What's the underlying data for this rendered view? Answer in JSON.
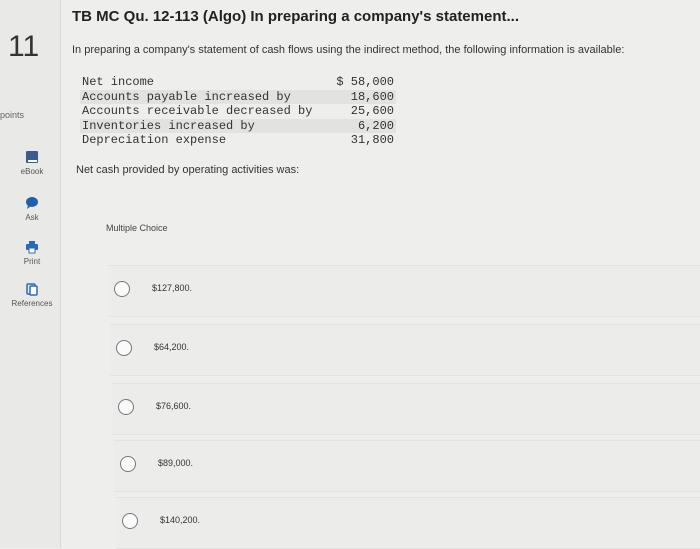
{
  "question": {
    "number": "11",
    "points_label": "points",
    "title": "TB MC Qu. 12-113 (Algo) In preparing a company's statement...",
    "intro": "In preparing a company's statement of cash flows using the indirect method, the following information is available:",
    "table": [
      {
        "label": "Net income",
        "value": "$ 58,000"
      },
      {
        "label": "Accounts payable increased by",
        "value": "18,600"
      },
      {
        "label": "Accounts receivable decreased by",
        "value": "25,600"
      },
      {
        "label": "Inventories increased by",
        "value": "6,200"
      },
      {
        "label": "Depreciation expense",
        "value": "31,800"
      }
    ],
    "prompt": "Net cash provided by operating activities was:",
    "choice_type_label": "Multiple Choice",
    "options": [
      {
        "text": "$127,800."
      },
      {
        "text": "$64,200."
      },
      {
        "text": "$76,600."
      },
      {
        "text": "$89,000."
      },
      {
        "text": "$140,200."
      }
    ]
  },
  "sidebar": {
    "tools": [
      {
        "label": "eBook",
        "icon": "book-icon",
        "color": "#3b5c8c"
      },
      {
        "label": "Ask",
        "icon": "chat-bubble-icon",
        "color": "#2060a8"
      },
      {
        "label": "Print",
        "icon": "printer-icon",
        "color": "#2a6bb8"
      },
      {
        "label": "References",
        "icon": "references-icon",
        "color": "#2a6bb8"
      }
    ]
  }
}
